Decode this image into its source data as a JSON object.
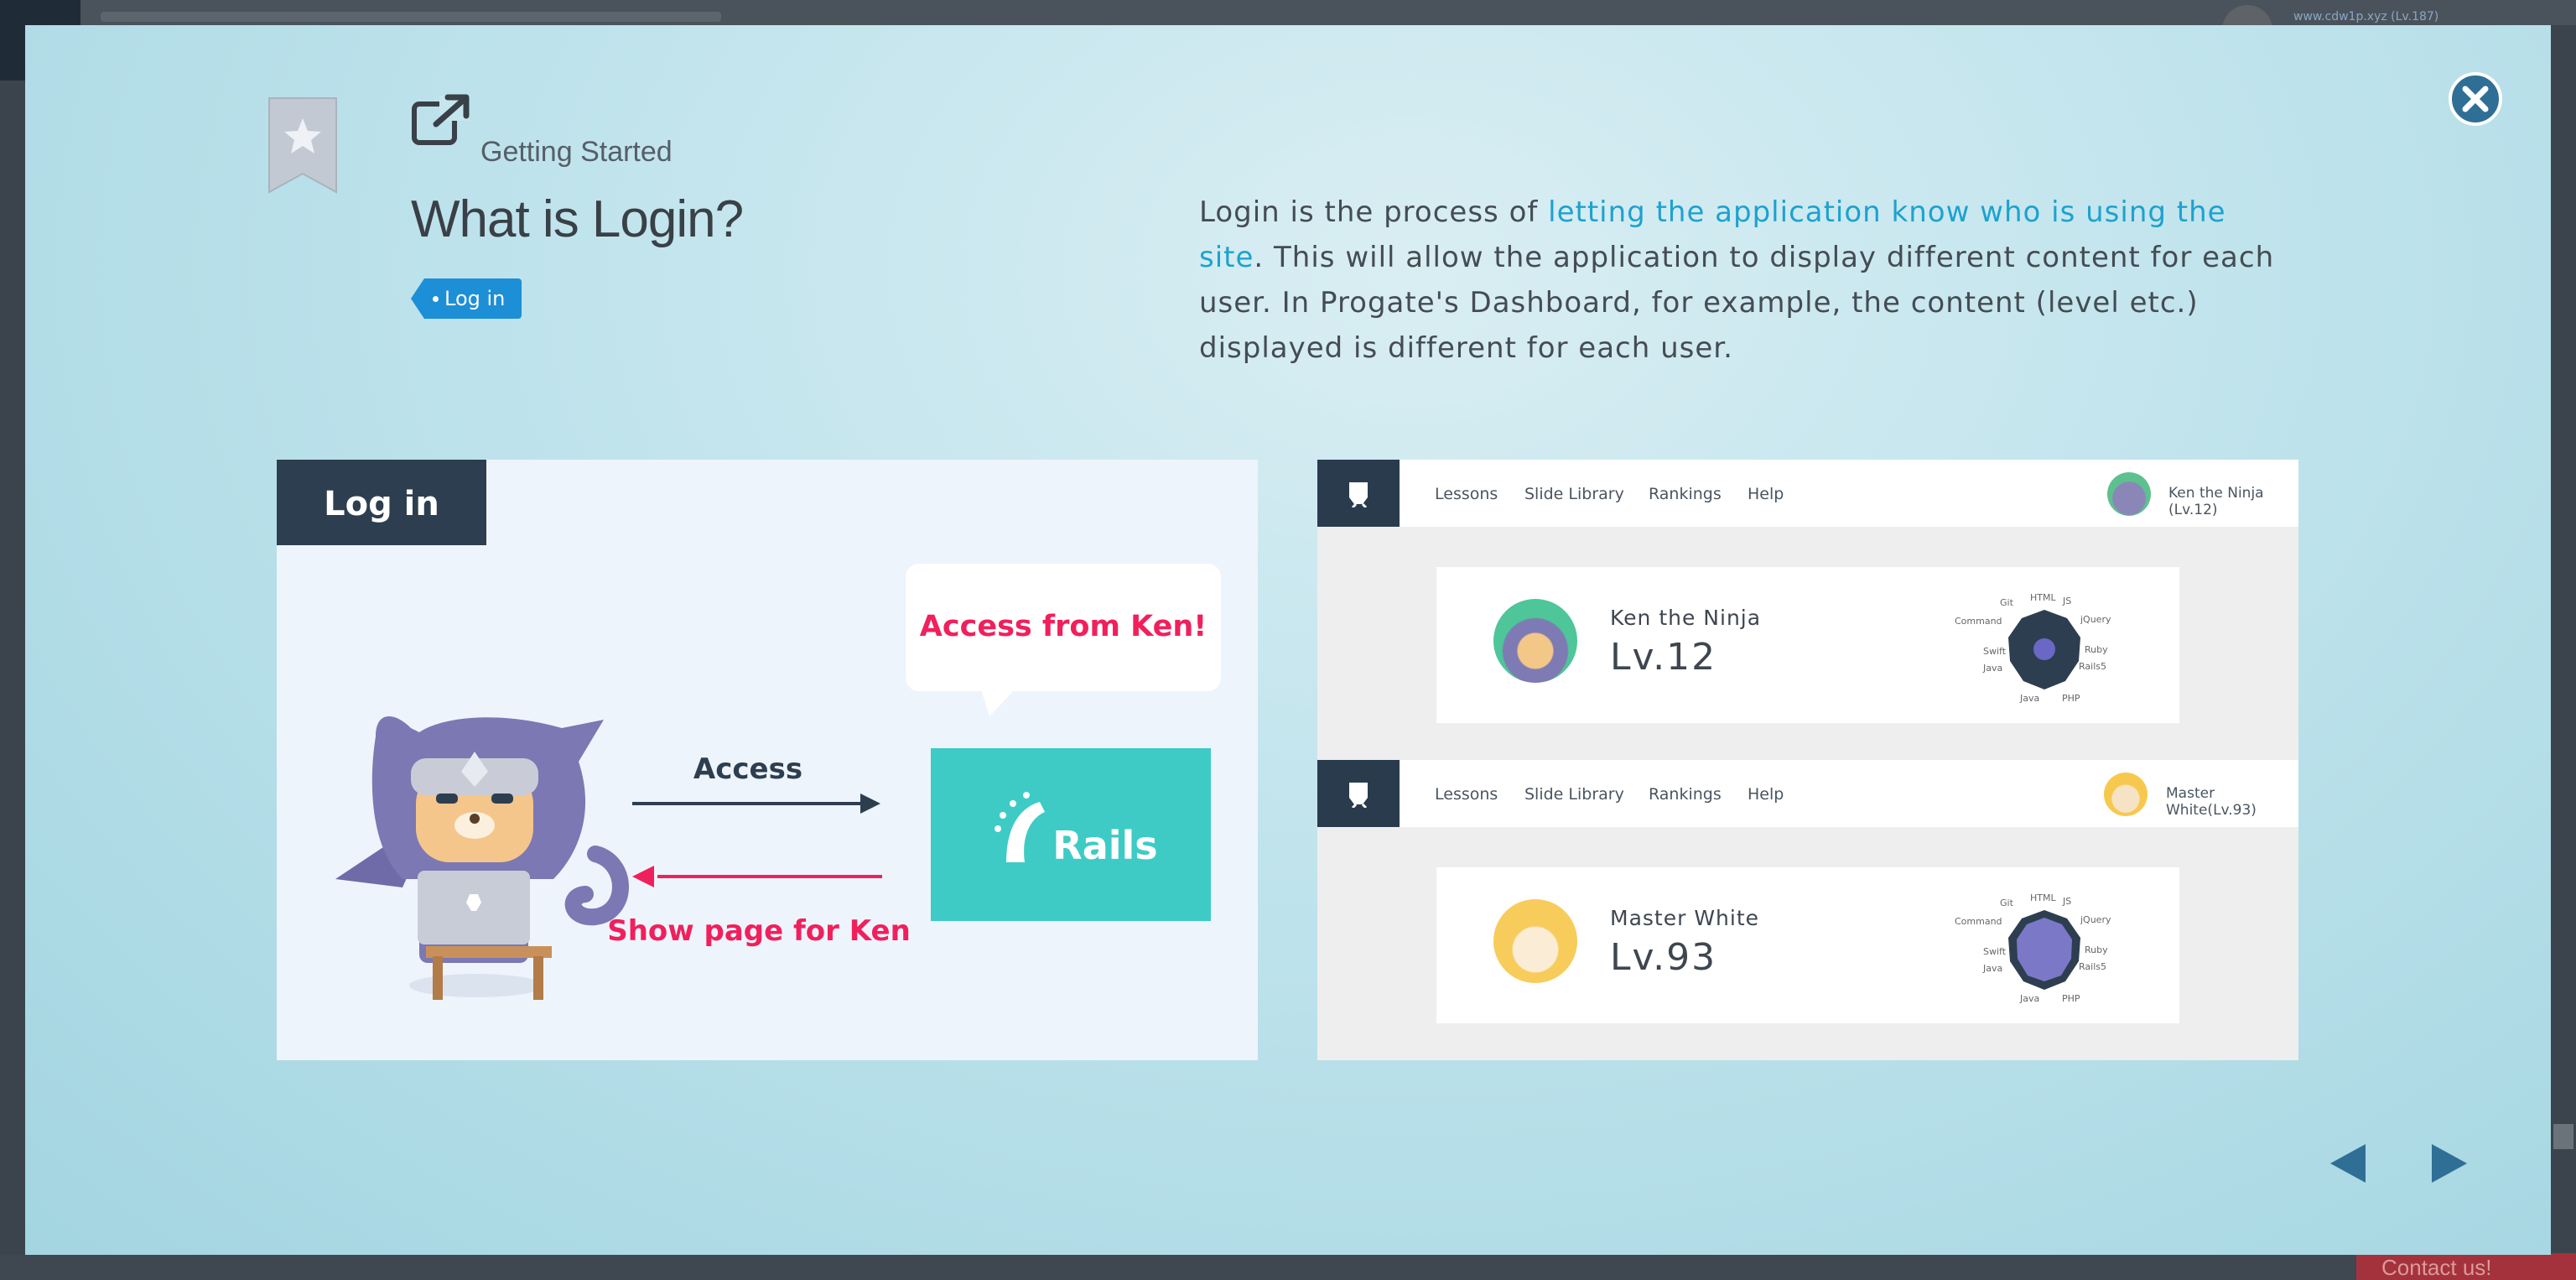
{
  "background_app": {
    "user_label": "www.cdw1p.xyz (Lv.187)",
    "contact_label": "Contact us!"
  },
  "slide": {
    "category": "Getting Started",
    "title": "What is Login?",
    "tag": "Log in",
    "description": {
      "before": "Login is the process of ",
      "highlight": "letting the application know who is using the site",
      "after": ". This will allow the application to display different content for each user. In Progate's Dashboard, for example, the content (level etc.) displayed is different for each user."
    }
  },
  "illustration_left": {
    "header": "Log in",
    "bubble": "Access from Ken!",
    "access_label": "Access",
    "response_label": "Show page for Ken",
    "server_label": "Rails"
  },
  "illustration_right": {
    "nav_items": [
      "Lessons",
      "Slide Library",
      "Rankings",
      "Help"
    ],
    "dashboards": [
      {
        "user_label": "Ken the Ninja (Lv.12)",
        "name": "Ken the Ninja",
        "level": "Lv.12"
      },
      {
        "user_label": "Master White(Lv.93)",
        "name": "Master White",
        "level": "Lv.93"
      }
    ],
    "radar_labels": [
      "Git",
      "HTML",
      "JS",
      "jQuery",
      "Ruby",
      "Rails5",
      "PHP",
      "Java",
      "Java",
      "Swift",
      "Command"
    ]
  },
  "colors": {
    "accent": "#1da2cf",
    "tag": "#1c8fd6",
    "close": "#2f6f95",
    "rails": "#3ecbc6",
    "alert": "#f0205c"
  }
}
